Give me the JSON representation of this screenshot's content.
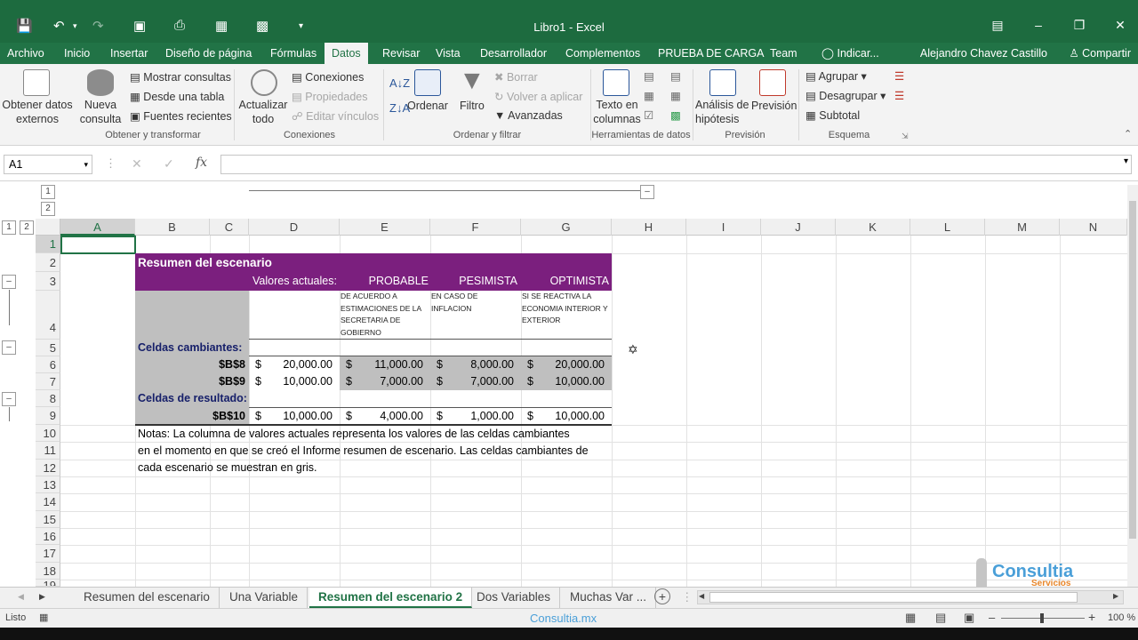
{
  "window": {
    "title": "Libro1 - Excel"
  },
  "tabs": [
    "Archivo",
    "Inicio",
    "Insertar",
    "Diseño de página",
    "Fórmulas",
    "Datos",
    "Revisar",
    "Vista",
    "Desarrollador",
    "Complementos",
    "PRUEBA DE CARGA",
    "Team",
    "Indicar..."
  ],
  "user": {
    "name": "Alejandro Chavez Castillo",
    "share": "Compartir"
  },
  "ribbon": {
    "get_external": "Obtener datos externos",
    "new_query": "Nueva consulta",
    "show_queries": "Mostrar consultas",
    "from_table": "Desde una tabla",
    "recent_sources": "Fuentes recientes",
    "group1": "Obtener y transformar",
    "refresh_all": "Actualizar todo",
    "connections": "Conexiones",
    "properties": "Propiedades",
    "edit_links": "Editar vínculos",
    "group2": "Conexiones",
    "sort": "Ordenar",
    "filter": "Filtro",
    "clear": "Borrar",
    "reapply": "Volver a aplicar",
    "advanced": "Avanzadas",
    "group3": "Ordenar y filtrar",
    "text_to_columns": "Texto en columnas",
    "group4": "Herramientas de datos",
    "whatif": "Análisis de hipótesis",
    "forecast": "Previsión",
    "group5": "Previsión",
    "group": "Agrupar",
    "ungroup": "Desagrupar",
    "subtotal": "Subtotal",
    "group6": "Esquema"
  },
  "formula_bar": {
    "name_box": "A1",
    "fx": "fx",
    "value": ""
  },
  "columns": [
    "A",
    "B",
    "C",
    "D",
    "E",
    "F",
    "G",
    "H",
    "I",
    "J",
    "K",
    "L",
    "M",
    "N"
  ],
  "rows": [
    "1",
    "2",
    "3",
    "4",
    "5",
    "6",
    "7",
    "8",
    "9",
    "10",
    "11",
    "12",
    "13",
    "14",
    "15",
    "16",
    "17",
    "18",
    "19"
  ],
  "outline_levels": [
    "1",
    "2"
  ],
  "report": {
    "title": "Resumen del escenario",
    "current_values": "Valores actuales:",
    "scenarios": [
      "PROBABLE",
      "PESIMISTA",
      "OPTIMISTA"
    ],
    "comments": [
      "DE ACUERDO A ESTIMACIONES DE LA SECRETARIA DE GOBIERNO",
      "EN CASO DE INFLACION",
      "SI SE REACTIVA LA ECONOMIA INTERIOR Y EXTERIOR"
    ],
    "changing_cells_label": "Celdas cambiantes:",
    "result_cells_label": "Celdas de resultado:",
    "currency": "$",
    "data_rows": [
      {
        "ref": "$B$8",
        "values": [
          "20,000.00",
          "11,000.00",
          "8,000.00",
          "20,000.00"
        ]
      },
      {
        "ref": "$B$9",
        "values": [
          "10,000.00",
          "7,000.00",
          "7,000.00",
          "10,000.00"
        ]
      },
      {
        "ref": "$B$10",
        "values": [
          "10,000.00",
          "4,000.00",
          "1,000.00",
          "10,000.00"
        ]
      }
    ],
    "notes": [
      "Notas: La columna de valores actuales representa los valores de las celdas cambiantes",
      "en el momento en que se creó el Informe resumen de escenario. Las celdas cambiantes de",
      "cada escenario se muestran en gris."
    ]
  },
  "watermark": {
    "brand": "Consultia",
    "sub": "Servicios",
    "site": "Consultia.mx"
  },
  "sheet_tabs": [
    "Resumen del escenario",
    "Una Variable",
    "Resumen del escenario 2",
    "Dos Variables",
    "Muchas Var ..."
  ],
  "active_sheet": 2,
  "status": {
    "ready": "Listo",
    "zoom": "100 %"
  },
  "colors": {
    "excel_green": "#217346",
    "header_purple": "#7b1f7e",
    "changing_gray": "#bfbfbf"
  }
}
